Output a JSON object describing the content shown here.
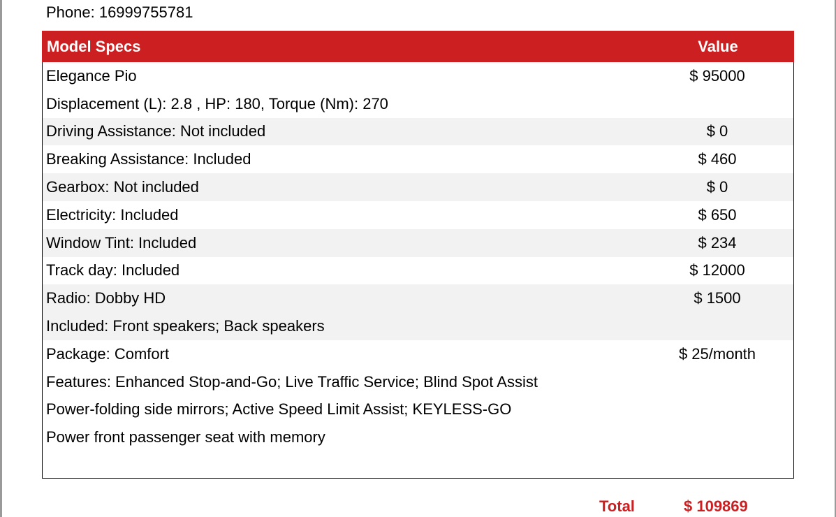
{
  "contact": {
    "phone": "Phone: 16999755781"
  },
  "table": {
    "header_spec": "Model Specs",
    "header_value": "Value",
    "rows": [
      {
        "spec": "Elegance Pio",
        "value": "$ 95000",
        "shaded": false
      },
      {
        "spec": "Displacement (L): 2.8 , HP: 180, Torque (Nm): 270",
        "value": "",
        "shaded": false
      },
      {
        "spec": "Driving Assistance: Not included",
        "value": "$ 0",
        "shaded": true
      },
      {
        "spec": "Breaking Assistance: Included",
        "value": "$ 460",
        "shaded": false
      },
      {
        "spec": "Gearbox: Not included",
        "value": "$ 0",
        "shaded": true
      },
      {
        "spec": "Electricity: Included",
        "value": "$ 650",
        "shaded": false
      },
      {
        "spec": "Window Tint: Included",
        "value": "$ 234",
        "shaded": true
      },
      {
        "spec": "Track day: Included",
        "value": "$ 12000",
        "shaded": false
      },
      {
        "spec": "Radio: Dobby HD",
        "value": "$ 1500",
        "shaded": true
      },
      {
        "spec": "Included: Front speakers; Back speakers",
        "value": "",
        "shaded": true
      },
      {
        "spec": "Package: Comfort",
        "value": "$ 25/month",
        "shaded": false
      },
      {
        "spec": "Features: Enhanced Stop-and-Go; Live Traffic Service; Blind Spot Assist",
        "value": "",
        "shaded": false
      },
      {
        "spec": "Power-folding side mirrors; Active Speed Limit Assist; KEYLESS-GO",
        "value": "",
        "shaded": false
      },
      {
        "spec": "Power front passenger seat with memory",
        "value": "",
        "shaded": false
      }
    ]
  },
  "total": {
    "label": "Total",
    "value": "$ 109869"
  },
  "colors": {
    "accent": "#cc1f21",
    "row_shade": "#f2f2f2"
  }
}
